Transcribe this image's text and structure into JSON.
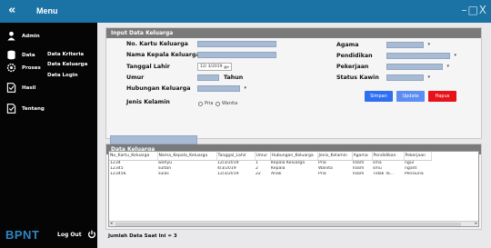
{
  "titlebar": {
    "back_icon": "«",
    "title": "Menu",
    "window_controls": "–□X"
  },
  "sidebar": {
    "user": "Admin",
    "data": "Data",
    "proses": "Proses",
    "hasil": "Hasil",
    "tentang": "Tentang",
    "data_kriteria": "Data Kriteria",
    "data_keluarga": "Data Keluarga",
    "data_login": "Data Login",
    "logo": "BPNT",
    "logout": "Log Out"
  },
  "form": {
    "header": "Input Data Keluarga",
    "no_kk_label": "No. Kartu Keluarga",
    "nama_kepala_label": "Nama Kepala Keluarga",
    "tanggal_lahir_label": "Tanggal Lahir",
    "tanggal_lahir_value": "12/ 3/2019",
    "umur_label": "Umur",
    "tahun_label": "Tahun",
    "hubungan_label": "Hubungan Keluarga",
    "jenis_kelamin_label": "Jenis Kelamin",
    "pria": "Pria",
    "wanita": "Wanita",
    "agama_label": "Agama",
    "pendidikan_label": "Pendidikan",
    "pekerjaan_label": "Pekerjaan",
    "status_kawin_label": "Status Kawin",
    "simpan": "Simpan",
    "update": "Update",
    "hapus": "Hapus"
  },
  "table_panel": {
    "header": "Data Keluarga",
    "columns": [
      "No_Kartu_Keluarga",
      "Nama_Kepala_Keluarga",
      "Tanggal_Lahir",
      "Umur",
      "Hubungan_Keluarga",
      "Jenis_Kelamin",
      "Agama",
      "Pendidikan",
      "Pekerjaan"
    ],
    "rows": [
      [
        "1234",
        "wahyu",
        "12/3/2019",
        "1",
        "Kepala Keluarga",
        "Pria",
        "Islam",
        "sma",
        "ngul"
      ],
      [
        "12345",
        "sultan",
        "4/3/2019",
        "2",
        "Kepala",
        "Wanita",
        "Islam",
        "smu",
        "ngant"
      ],
      [
        "123456",
        "sulas",
        "12/3/2019",
        "22",
        "Anak",
        "Pria",
        "Islam",
        "Tidak Ta...",
        "Pensiuna"
      ]
    ],
    "jumlah": "Jumlah Data Saat Ini = 3"
  },
  "colors": {
    "titlebar": "#1b72a5",
    "sidebar": "#050505",
    "simpan": "#2e6ff2",
    "update": "#5b8df2",
    "hapus": "#e8121b"
  }
}
